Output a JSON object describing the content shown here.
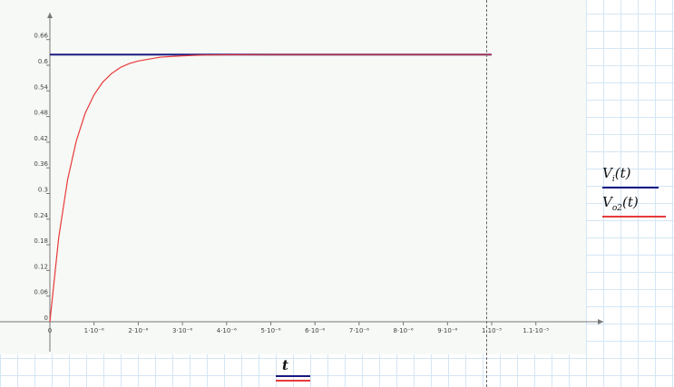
{
  "chart_data": {
    "type": "line",
    "xlabel": "t",
    "xlim": [
      0,
      1.15e-05
    ],
    "ylim": [
      0,
      0.7
    ],
    "x_ticks": [
      {
        "value": 0,
        "label": "0"
      },
      {
        "value": 1e-06,
        "label": "1·10⁻⁶"
      },
      {
        "value": 2e-06,
        "label": "2·10⁻⁶"
      },
      {
        "value": 3e-06,
        "label": "3·10⁻⁶"
      },
      {
        "value": 4e-06,
        "label": "4·10⁻⁶"
      },
      {
        "value": 5e-06,
        "label": "5·10⁻⁶"
      },
      {
        "value": 6e-06,
        "label": "6·10⁻⁶"
      },
      {
        "value": 7e-06,
        "label": "7·10⁻⁶"
      },
      {
        "value": 8e-06,
        "label": "8·10⁻⁶"
      },
      {
        "value": 9e-06,
        "label": "9·10⁻⁶"
      },
      {
        "value": 1e-05,
        "label": "1·10⁻⁵"
      },
      {
        "value": 1.1e-05,
        "label": "1.1·10⁻⁵"
      }
    ],
    "y_ticks": [
      {
        "value": 0,
        "label": "0"
      },
      {
        "value": 0.06,
        "label": "0.06"
      },
      {
        "value": 0.12,
        "label": "0.12"
      },
      {
        "value": 0.18,
        "label": "0.18"
      },
      {
        "value": 0.24,
        "label": "0.24"
      },
      {
        "value": 0.3,
        "label": "0.3"
      },
      {
        "value": 0.36,
        "label": "0.36"
      },
      {
        "value": 0.42,
        "label": "0.42"
      },
      {
        "value": 0.48,
        "label": "0.48"
      },
      {
        "value": 0.54,
        "label": "0.54"
      },
      {
        "value": 0.6,
        "label": "0.6"
      },
      {
        "value": 0.66,
        "label": "0.66"
      }
    ],
    "grid": false,
    "legend_position": "right",
    "series": [
      {
        "name": "Vi(t)",
        "legend_var": "V",
        "legend_sub": "i",
        "legend_arg": "(t)",
        "color": "#1a1a80",
        "x": [
          0,
          1e-05
        ],
        "y": [
          0.625,
          0.625
        ]
      },
      {
        "name": "Vo2(t)",
        "legend_var": "V",
        "legend_sub": "o2",
        "legend_arg": "(t)",
        "color": "#e83a3a",
        "x": [
          0,
          2e-07,
          4e-07,
          6e-07,
          8e-07,
          1e-06,
          1.2e-06,
          1.4e-06,
          1.6e-06,
          1.8e-06,
          2e-06,
          2.5e-06,
          3e-06,
          3.5e-06,
          4e-06,
          5e-06,
          6e-06,
          7e-06,
          8e-06,
          9e-06,
          1e-05
        ],
        "y": [
          0,
          0.197,
          0.332,
          0.424,
          0.488,
          0.531,
          0.561,
          0.581,
          0.595,
          0.604,
          0.61,
          0.619,
          0.622,
          0.624,
          0.6245,
          0.625,
          0.625,
          0.625,
          0.625,
          0.625,
          0.625
        ]
      }
    ]
  }
}
